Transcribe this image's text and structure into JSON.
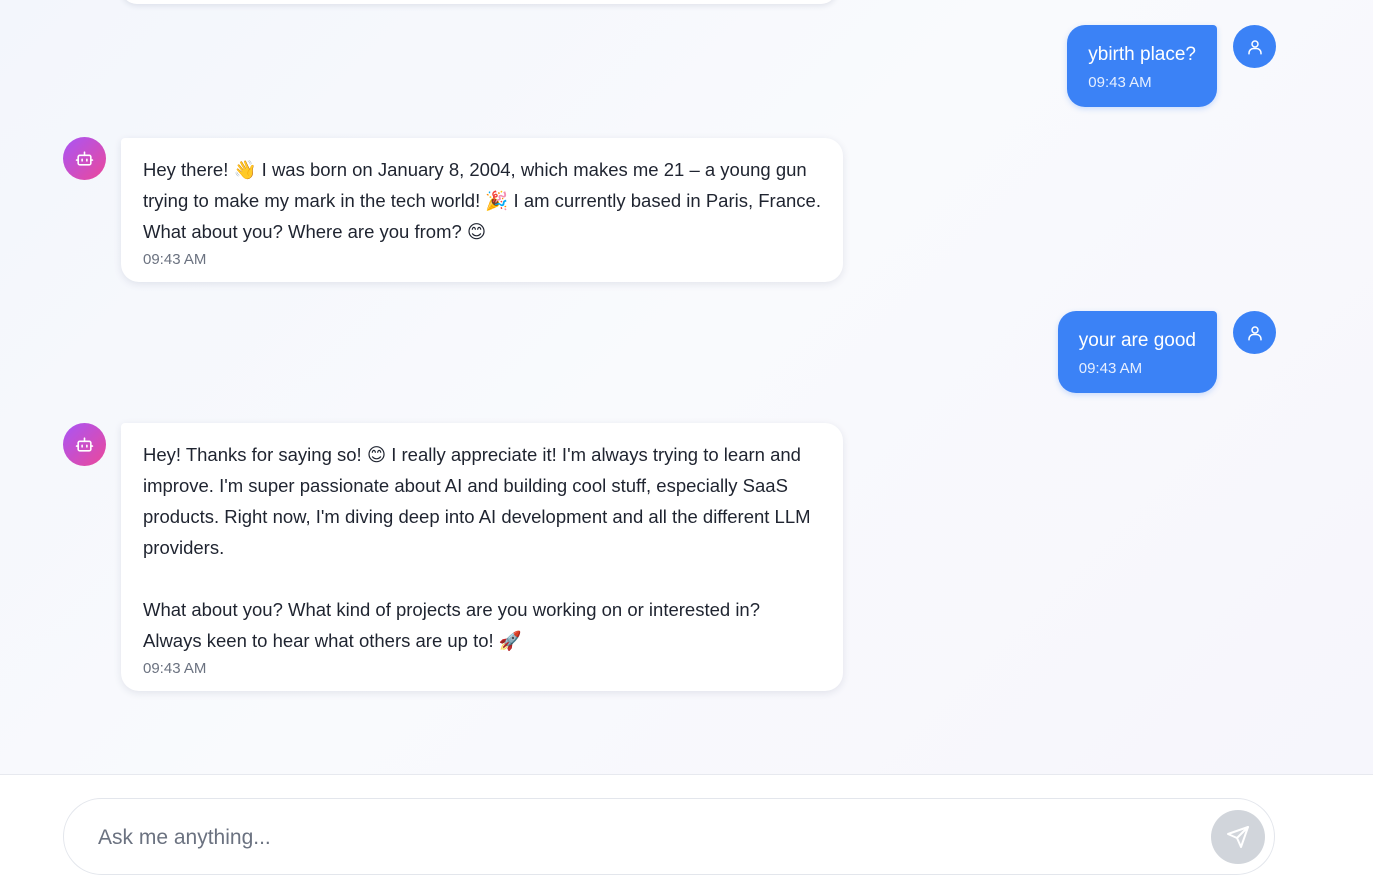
{
  "messages": [
    {
      "role": "user",
      "text": "ybirth place?",
      "time": "09:43 AM"
    },
    {
      "role": "bot",
      "text": "Hey there! 👋 I was born on January 8, 2004, which makes me 21 – a young gun trying to make my mark in the tech world! 🎉 I am currently based in Paris, France. What about you? Where are you from? 😊",
      "time": "09:43 AM"
    },
    {
      "role": "user",
      "text": "your are good",
      "time": "09:43 AM"
    },
    {
      "role": "bot",
      "text": "Hey! Thanks for saying so! 😊 I really appreciate it! I'm always trying to learn and improve. I'm super passionate about AI and building cool stuff, especially SaaS products. Right now, I'm diving deep into AI development and all the different LLM providers.\n\nWhat about you? What kind of projects are you working on or interested in? Always keen to hear what others are up to! 🚀",
      "time": "09:43 AM"
    }
  ],
  "composer": {
    "placeholder": "Ask me anything...",
    "send_icon": "send-icon"
  },
  "colors": {
    "user_bubble": "#3b82f6",
    "bot_avatar_gradient_start": "#a855f7",
    "bot_avatar_gradient_end": "#ec4899",
    "send_button_disabled": "#d1d5db"
  }
}
